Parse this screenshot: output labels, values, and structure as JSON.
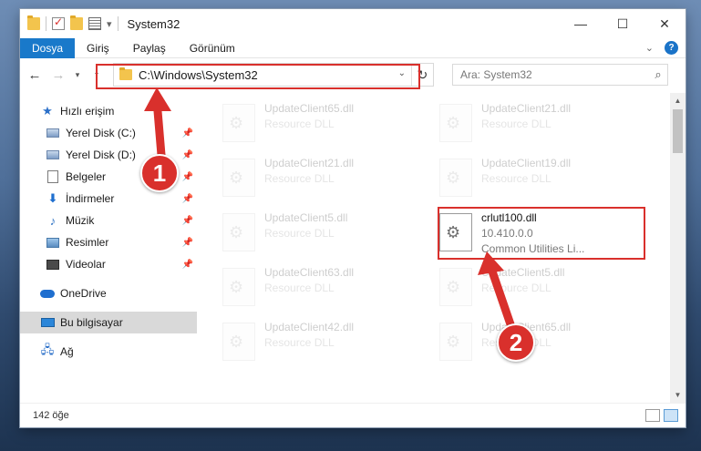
{
  "window": {
    "title": "System32",
    "controls": {
      "minimize": "—",
      "maximize": "☐",
      "close": "✕"
    }
  },
  "ribbon": {
    "tabs": [
      "Dosya",
      "Giriş",
      "Paylaş",
      "Görünüm"
    ],
    "active_tab": "Dosya"
  },
  "address": {
    "path": "C:\\Windows\\System32",
    "search_placeholder": "Ara: System32",
    "refresh_glyph": "↻",
    "back_glyph": "←",
    "forward_glyph": "→",
    "recent_glyph": "▾",
    "up_glyph": "↑",
    "dropdown_glyph": "⌄",
    "search_glyph": "⌕"
  },
  "nav": {
    "quick_access": "Hızlı erişim",
    "items": [
      {
        "label": "Yerel Disk (C:)",
        "icon": "disk-icon"
      },
      {
        "label": "Yerel Disk (D:)",
        "icon": "disk-icon"
      },
      {
        "label": "Belgeler",
        "icon": "documents-icon"
      },
      {
        "label": "İndirmeler",
        "icon": "download-icon"
      },
      {
        "label": "Müzik",
        "icon": "music-icon"
      },
      {
        "label": "Resimler",
        "icon": "pictures-icon"
      },
      {
        "label": "Videolar",
        "icon": "videos-icon"
      }
    ],
    "onedrive": "OneDrive",
    "this_pc": "Bu bilgisayar",
    "network": "Ağ"
  },
  "files": {
    "left": [
      {
        "name": "UpdateClient65.dll",
        "type": "Resource DLL"
      },
      {
        "name": "UpdateClient21.dll",
        "type": "Resource DLL"
      },
      {
        "name": "UpdateClient5.dll",
        "type": "Resource DLL"
      },
      {
        "name": "UpdateClient63.dll",
        "type": "Resource DLL"
      },
      {
        "name": "UpdateClient42.dll",
        "type": "Resource DLL"
      }
    ],
    "right": [
      {
        "name": "UpdateClient21.dll",
        "type": "Resource DLL"
      },
      {
        "name": "UpdateClient19.dll",
        "type": "Resource DLL"
      },
      {
        "name": "crlutl100.dll",
        "version": "10.410.0.0",
        "type": "Common Utilities Li..."
      },
      {
        "name": "UpdateClient5.dll",
        "type": "Resource DLL"
      },
      {
        "name": "UpdateClient65.dll",
        "type": "Resource DLL"
      }
    ]
  },
  "status": {
    "count": "142 öğe"
  },
  "callouts": [
    {
      "number": "1"
    },
    {
      "number": "2"
    }
  ],
  "colors": {
    "accent": "#1979ca",
    "highlight": "#d9302c"
  }
}
